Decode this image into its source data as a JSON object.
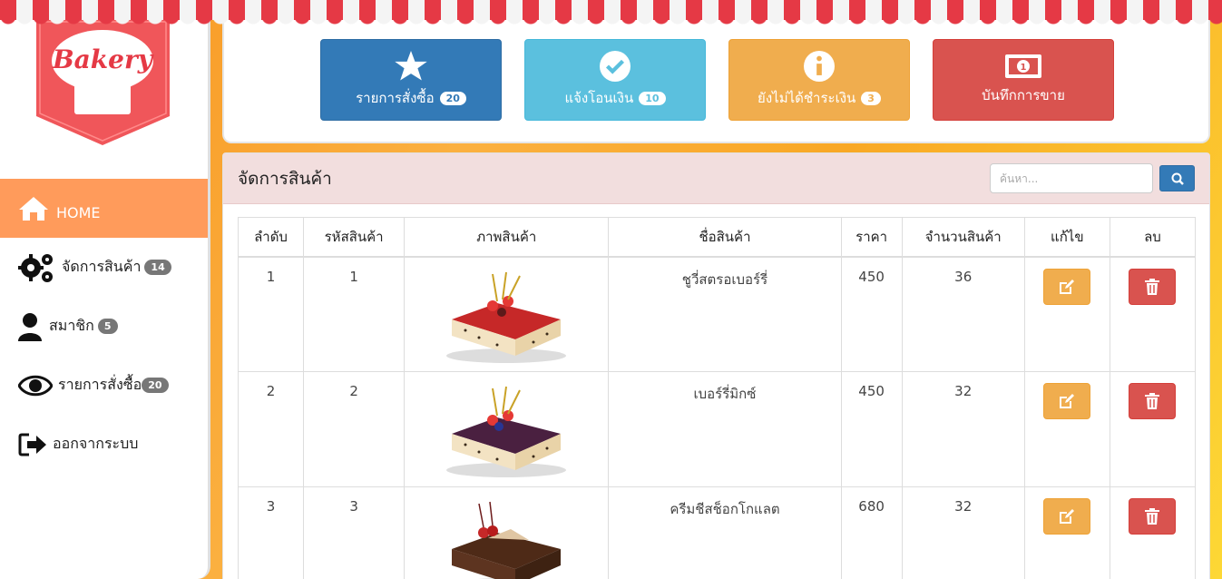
{
  "logo": {
    "text": "Bakery"
  },
  "sidebar": {
    "items": [
      {
        "label": "HOME",
        "icon": "home-icon",
        "badge": ""
      },
      {
        "label": "จัดการสินค้า",
        "icon": "gears-icon",
        "badge": "14"
      },
      {
        "label": "สมาชิก",
        "icon": "user-icon",
        "badge": "5"
      },
      {
        "label": "รายการสั่งซื้อ",
        "icon": "eye-icon",
        "badge": "20"
      },
      {
        "label": "ออกจากระบบ",
        "icon": "sign-out-icon",
        "badge": ""
      }
    ]
  },
  "tiles": [
    {
      "label": "รายการสั่งซื้อ",
      "badge": "20",
      "icon": "star-icon",
      "color": "#337ab7"
    },
    {
      "label": "แจ้งโอนเงิน",
      "badge": "10",
      "icon": "check-circle-icon",
      "color": "#5bc0de"
    },
    {
      "label": "ยังไม่ได้ชำระเงิน",
      "badge": "3",
      "icon": "info-circle-icon",
      "color": "#f0ad4e"
    },
    {
      "label": "บันทึกการขาย",
      "badge": "",
      "icon": "money-icon",
      "color": "#d9534f"
    }
  ],
  "manage": {
    "title": "จัดการสินค้า",
    "search_placeholder": "ค้นหา..."
  },
  "table": {
    "headers": [
      "ลำดับ",
      "รหัสสินค้า",
      "ภาพสินค้า",
      "ชื่อสินค้า",
      "ราคา",
      "จำนวนสินค้า",
      "แก้ไข",
      "ลบ"
    ],
    "rows": [
      {
        "no": "1",
        "code": "1",
        "name": "ชูวี่สตรอเบอร์รี่",
        "price": "450",
        "qty": "36"
      },
      {
        "no": "2",
        "code": "2",
        "name": "เบอร์รี่มิกซ์",
        "price": "450",
        "qty": "32"
      },
      {
        "no": "3",
        "code": "3",
        "name": "ครีมชีสช็อกโกแลต",
        "price": "680",
        "qty": "32"
      }
    ]
  }
}
